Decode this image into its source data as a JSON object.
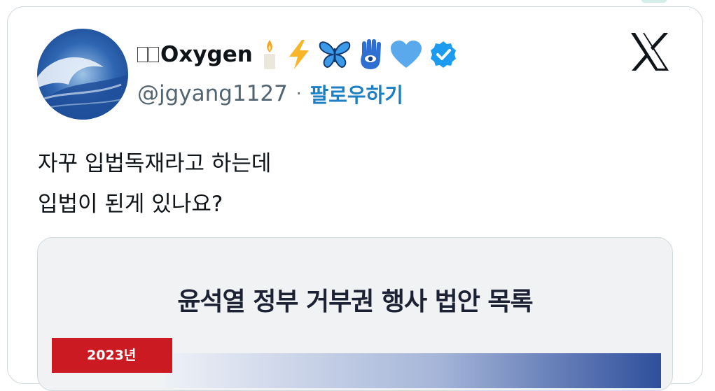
{
  "tweet": {
    "display_name": "Oxygen",
    "emojis": [
      "candle-icon",
      "lightning-icon",
      "butterfly-icon",
      "hamsa-icon",
      "blue-heart-icon",
      "verified-badge-icon"
    ],
    "handle": "@jgyang1127",
    "separator": "·",
    "follow_label": "팔로우하기",
    "text_line1": "자꾸 입법독재라고 하는데",
    "text_line2": "입법이 된게 있나요?"
  },
  "media": {
    "title": "윤석열 정부 거부권 행사 법안 목록",
    "year_badge": "2023년"
  },
  "colors": {
    "follow": "#1d7fc4",
    "verified": "#1d9bf0",
    "badge_red": "#cc1a22"
  }
}
